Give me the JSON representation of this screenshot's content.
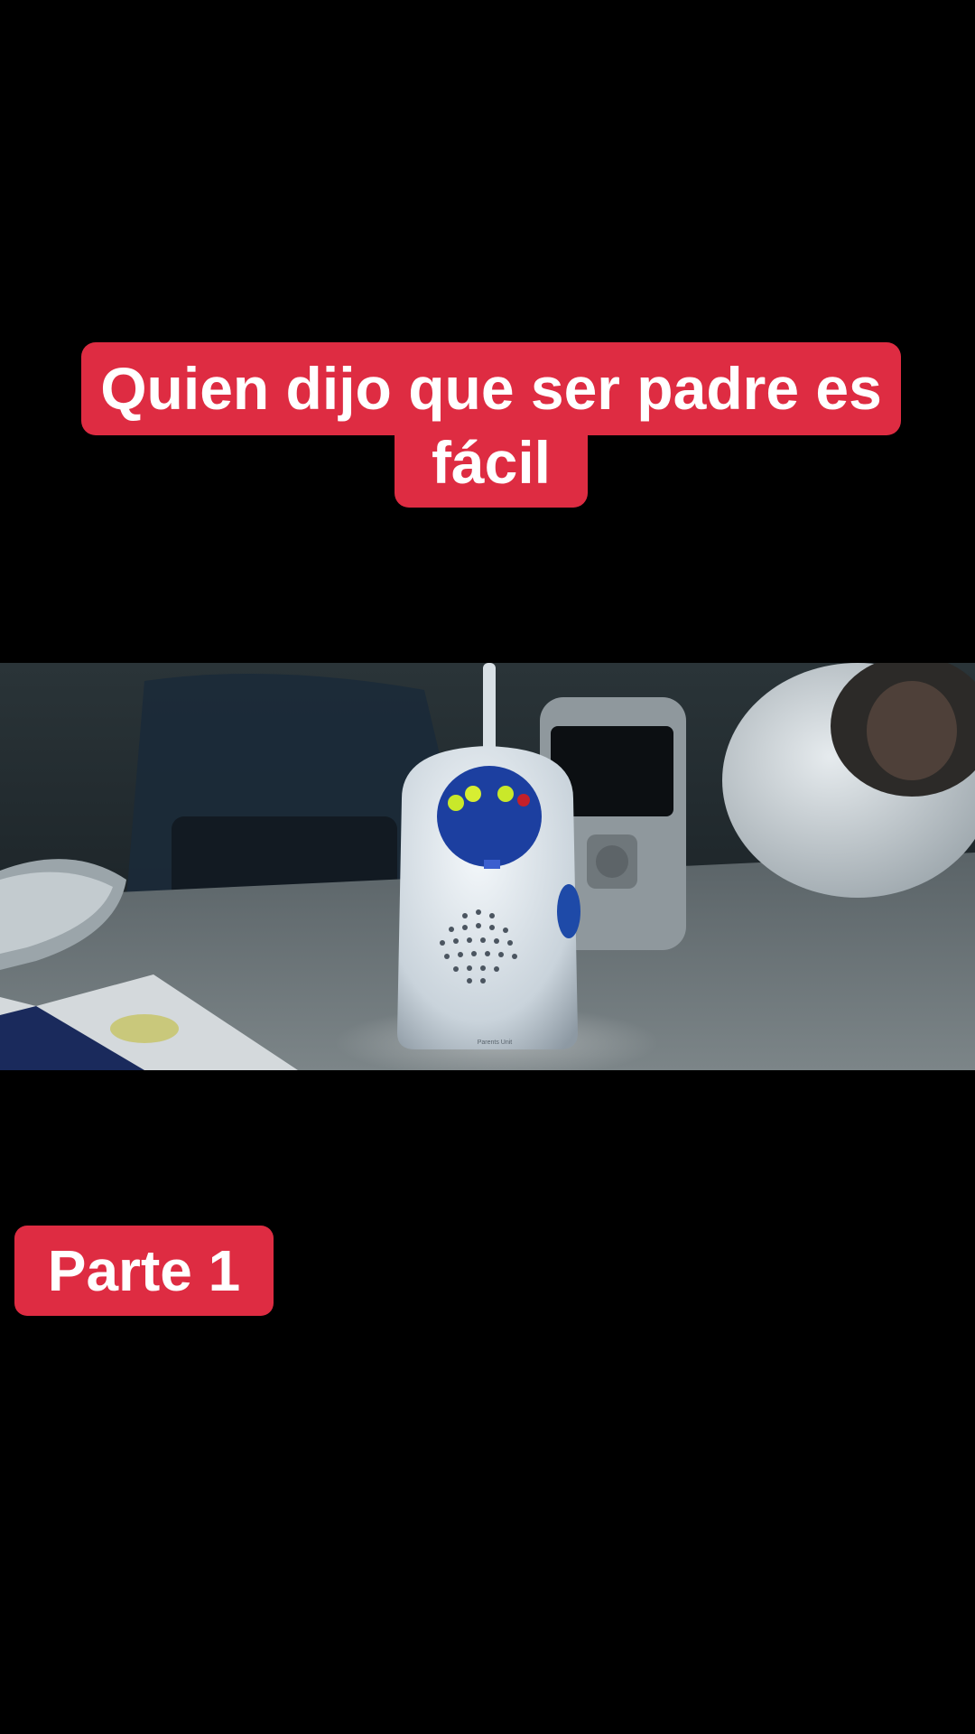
{
  "caption": {
    "line1": "Quien dijo que ser padre es",
    "line2": "fácil"
  },
  "part_label": "Parte 1",
  "video": {
    "device_brand": "Parents Unit"
  },
  "colors": {
    "caption_bg": "#de2c42",
    "caption_text": "#ffffff",
    "background": "#000000"
  }
}
